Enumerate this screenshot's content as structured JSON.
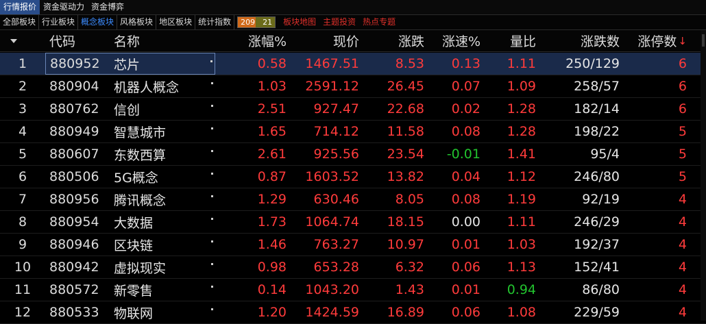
{
  "top_tabs": [
    {
      "label": "行情报价",
      "active": true
    },
    {
      "label": "资金驱动力",
      "active": false
    },
    {
      "label": "资金博弈",
      "active": false
    }
  ],
  "sub_tabs": [
    {
      "label": "全部板块",
      "active": false
    },
    {
      "label": "行业板块",
      "active": false
    },
    {
      "label": "概念板块",
      "active": true
    },
    {
      "label": "风格板块",
      "active": false
    },
    {
      "label": "地区板块",
      "active": false
    },
    {
      "label": "统计指数",
      "active": false
    }
  ],
  "counter": {
    "up": "209",
    "down": "21"
  },
  "sub_links": [
    "板块地图",
    "主题投资",
    "热点专题"
  ],
  "columns": {
    "code": "代码",
    "name": "名称",
    "pct": "涨幅%",
    "price": "现价",
    "chg": "涨跌",
    "speed": "涨速%",
    "vol_ratio": "量比",
    "up_down": "涨跌数",
    "limit_up": "涨停数",
    "sort_indicator": "↓"
  },
  "rows": [
    {
      "idx": "1",
      "code": "880952",
      "name": "芯片",
      "pct": "0.58",
      "price": "1467.51",
      "chg": "8.53",
      "speed": "0.13",
      "speed_dir": "up",
      "vol_ratio": "1.11",
      "vol_dir": "up",
      "up_down": "250/129",
      "limit_up": "6",
      "selected": true
    },
    {
      "idx": "2",
      "code": "880904",
      "name": "机器人概念",
      "pct": "1.03",
      "price": "2591.12",
      "chg": "26.45",
      "speed": "0.07",
      "speed_dir": "up",
      "vol_ratio": "1.09",
      "vol_dir": "up",
      "up_down": "258/57",
      "limit_up": "6",
      "selected": false
    },
    {
      "idx": "3",
      "code": "880762",
      "name": "信创",
      "pct": "2.51",
      "price": "927.47",
      "chg": "22.68",
      "speed": "0.02",
      "speed_dir": "up",
      "vol_ratio": "1.28",
      "vol_dir": "up",
      "up_down": "182/14",
      "limit_up": "6",
      "selected": false
    },
    {
      "idx": "4",
      "code": "880949",
      "name": "智慧城市",
      "pct": "1.65",
      "price": "714.12",
      "chg": "11.58",
      "speed": "0.08",
      "speed_dir": "up",
      "vol_ratio": "1.28",
      "vol_dir": "up",
      "up_down": "198/22",
      "limit_up": "5",
      "selected": false
    },
    {
      "idx": "5",
      "code": "880607",
      "name": "东数西算",
      "pct": "2.61",
      "price": "925.56",
      "chg": "23.54",
      "speed": "-0.01",
      "speed_dir": "down",
      "vol_ratio": "1.41",
      "vol_dir": "up",
      "up_down": "95/4",
      "limit_up": "5",
      "selected": false
    },
    {
      "idx": "6",
      "code": "880506",
      "name": "5G概念",
      "pct": "0.87",
      "price": "1603.52",
      "chg": "13.82",
      "speed": "0.04",
      "speed_dir": "up",
      "vol_ratio": "1.12",
      "vol_dir": "up",
      "up_down": "246/80",
      "limit_up": "5",
      "selected": false
    },
    {
      "idx": "7",
      "code": "880956",
      "name": "腾讯概念",
      "pct": "1.29",
      "price": "630.46",
      "chg": "8.05",
      "speed": "0.08",
      "speed_dir": "up",
      "vol_ratio": "1.19",
      "vol_dir": "up",
      "up_down": "92/19",
      "limit_up": "4",
      "selected": false
    },
    {
      "idx": "8",
      "code": "880954",
      "name": "大数据",
      "pct": "1.73",
      "price": "1064.74",
      "chg": "18.15",
      "speed": "0.00",
      "speed_dir": "flat",
      "vol_ratio": "1.11",
      "vol_dir": "up",
      "up_down": "246/29",
      "limit_up": "4",
      "selected": false
    },
    {
      "idx": "9",
      "code": "880946",
      "name": "区块链",
      "pct": "1.46",
      "price": "763.27",
      "chg": "10.97",
      "speed": "0.01",
      "speed_dir": "up",
      "vol_ratio": "1.03",
      "vol_dir": "up",
      "up_down": "192/37",
      "limit_up": "4",
      "selected": false
    },
    {
      "idx": "10",
      "code": "880942",
      "name": "虚拟现实",
      "pct": "0.98",
      "price": "653.28",
      "chg": "6.32",
      "speed": "0.06",
      "speed_dir": "up",
      "vol_ratio": "1.13",
      "vol_dir": "up",
      "up_down": "152/41",
      "limit_up": "4",
      "selected": false
    },
    {
      "idx": "11",
      "code": "880572",
      "name": "新零售",
      "pct": "0.14",
      "price": "1043.20",
      "chg": "1.43",
      "speed": "0.01",
      "speed_dir": "up",
      "vol_ratio": "0.94",
      "vol_dir": "down",
      "up_down": "86/80",
      "limit_up": "4",
      "selected": false
    },
    {
      "idx": "12",
      "code": "880533",
      "name": "物联网",
      "pct": "1.20",
      "price": "1424.59",
      "chg": "16.89",
      "speed": "0.06",
      "speed_dir": "up",
      "vol_ratio": "1.08",
      "vol_dir": "up",
      "up_down": "229/59",
      "limit_up": "4",
      "selected": false
    }
  ],
  "colors": {
    "up": "#ff3b3b",
    "down": "#22c32e",
    "active_tab": "#2a4d8a",
    "active_subtab": "#3c8cff",
    "selected_row": "#1a2a4a"
  }
}
